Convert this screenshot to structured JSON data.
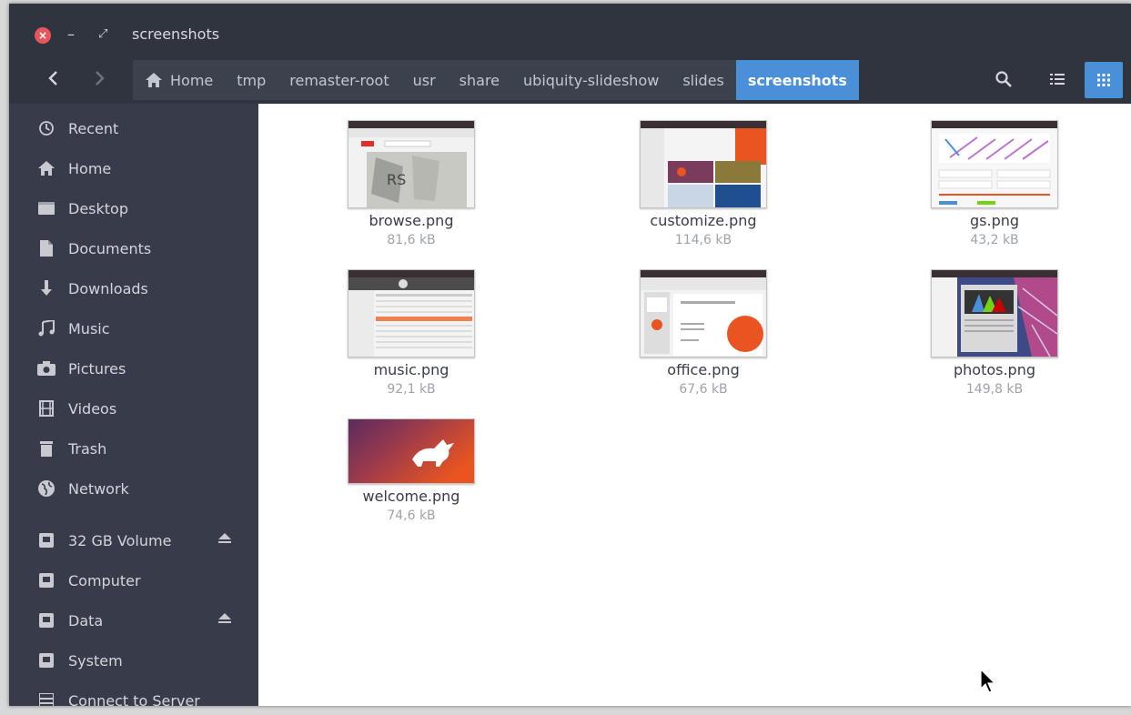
{
  "window": {
    "title": "screenshots"
  },
  "toolbar": {
    "breadcrumbs": [
      "Home",
      "tmp",
      "remaster-root",
      "usr",
      "share",
      "ubiquity-slideshow",
      "slides",
      "screenshots"
    ],
    "search_icon": "search-icon",
    "list_view_icon": "list-view-icon",
    "grid_view_icon": "grid-view-icon",
    "accent": "#4a90d9"
  },
  "sidebar": {
    "items": [
      {
        "label": "Recent",
        "icon": "clock-icon"
      },
      {
        "label": "Home",
        "icon": "home-icon"
      },
      {
        "label": "Desktop",
        "icon": "desktop-icon"
      },
      {
        "label": "Documents",
        "icon": "document-icon"
      },
      {
        "label": "Downloads",
        "icon": "download-icon"
      },
      {
        "label": "Music",
        "icon": "music-icon"
      },
      {
        "label": "Pictures",
        "icon": "camera-icon"
      },
      {
        "label": "Videos",
        "icon": "film-icon"
      },
      {
        "label": "Trash",
        "icon": "trash-icon"
      },
      {
        "label": "Network",
        "icon": "globe-icon"
      }
    ],
    "devices": [
      {
        "label": "32 GB Volume",
        "icon": "drive-icon",
        "eject": true
      },
      {
        "label": "Computer",
        "icon": "drive-icon",
        "eject": false
      },
      {
        "label": "Data",
        "icon": "drive-icon",
        "eject": true
      },
      {
        "label": "System",
        "icon": "drive-icon",
        "eject": false
      },
      {
        "label": "Connect to Server",
        "icon": "server-icon",
        "eject": false
      }
    ]
  },
  "files": [
    {
      "name": "browse.png",
      "size": "81,6 kB"
    },
    {
      "name": "customize.png",
      "size": "114,6 kB"
    },
    {
      "name": "gs.png",
      "size": "43,2 kB"
    },
    {
      "name": "music.png",
      "size": "92,1 kB"
    },
    {
      "name": "office.png",
      "size": "67,6 kB"
    },
    {
      "name": "photos.png",
      "size": "149,8 kB"
    },
    {
      "name": "welcome.png",
      "size": "74,6 kB"
    }
  ]
}
